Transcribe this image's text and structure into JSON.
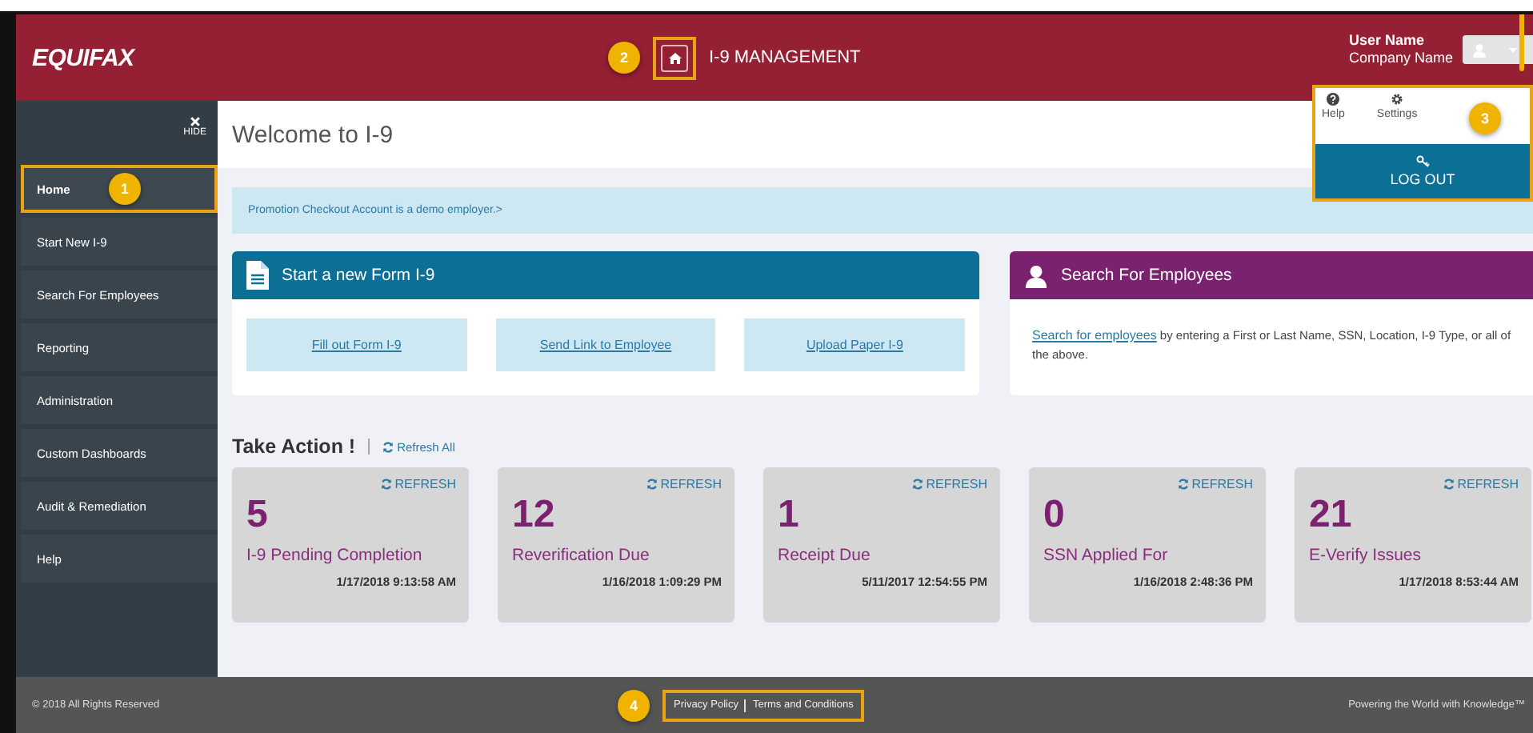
{
  "header": {
    "logo": "EQUIFAX",
    "title": "I-9 MANAGEMENT",
    "home_button": {
      "highlighted": true,
      "callout": "2"
    },
    "user_name": "User Name",
    "company_name": "Company Name"
  },
  "user_menu": {
    "highlighted": true,
    "callout": "3",
    "items": [
      {
        "kind": "help",
        "label": "Help"
      },
      {
        "kind": "settings",
        "label": "Settings"
      }
    ],
    "logout": "LOG OUT"
  },
  "sidebar": {
    "hide": "HIDE",
    "items": [
      {
        "label": "Home",
        "selected": true,
        "highlighted": true,
        "callout": "1"
      },
      {
        "label": "Start New I-9",
        "selected": false,
        "highlighted": false
      },
      {
        "label": "Search For Employees",
        "selected": false,
        "highlighted": false
      },
      {
        "label": "Reporting",
        "selected": false,
        "highlighted": false
      },
      {
        "label": "Administration",
        "selected": false,
        "highlighted": false
      },
      {
        "label": "Custom Dashboards",
        "selected": false,
        "highlighted": false
      },
      {
        "label": "Audit & Remediation",
        "selected": false,
        "highlighted": false
      },
      {
        "label": "Help",
        "selected": false,
        "highlighted": false
      }
    ]
  },
  "page_title": "Welcome to I-9",
  "notice": "Promotion Checkout Account is a demo employer.>",
  "new_form_card": {
    "title": "Start a new Form I-9",
    "links": [
      "Fill out Form I-9",
      "Send Link to Employee",
      "Upload Paper I-9"
    ]
  },
  "search_card": {
    "title": "Search For Employees",
    "link": "Search for employees",
    "text": " by entering a First or Last Name, SSN, Location, I-9 Type, or all of the above."
  },
  "take_action": {
    "title": "Take Action !",
    "refresh_all": "Refresh All",
    "tiles": [
      {
        "refresh": "REFRESH",
        "count": "5",
        "label": "I-9 Pending Completion",
        "date": "1/17/2018 9:13:58 AM"
      },
      {
        "refresh": "REFRESH",
        "count": "12",
        "label": "Reverification Due",
        "date": "1/16/2018 1:09:29 PM"
      },
      {
        "refresh": "REFRESH",
        "count": "1",
        "label": "Receipt Due",
        "date": "5/11/2017 12:54:55 PM"
      },
      {
        "refresh": "REFRESH",
        "count": "0",
        "label": "SSN Applied For",
        "date": "1/16/2018 2:48:36 PM"
      },
      {
        "refresh": "REFRESH",
        "count": "21",
        "label": "E-Verify Issues",
        "date": "1/17/2018 8:53:44 AM"
      }
    ]
  },
  "footer": {
    "copyright": "© 2018 All Rights Reserved",
    "links": [
      "Privacy Policy",
      "Terms and Conditions"
    ],
    "links_highlighted": true,
    "callout": "4",
    "tagline": "Powering the World with Knowledge™"
  }
}
